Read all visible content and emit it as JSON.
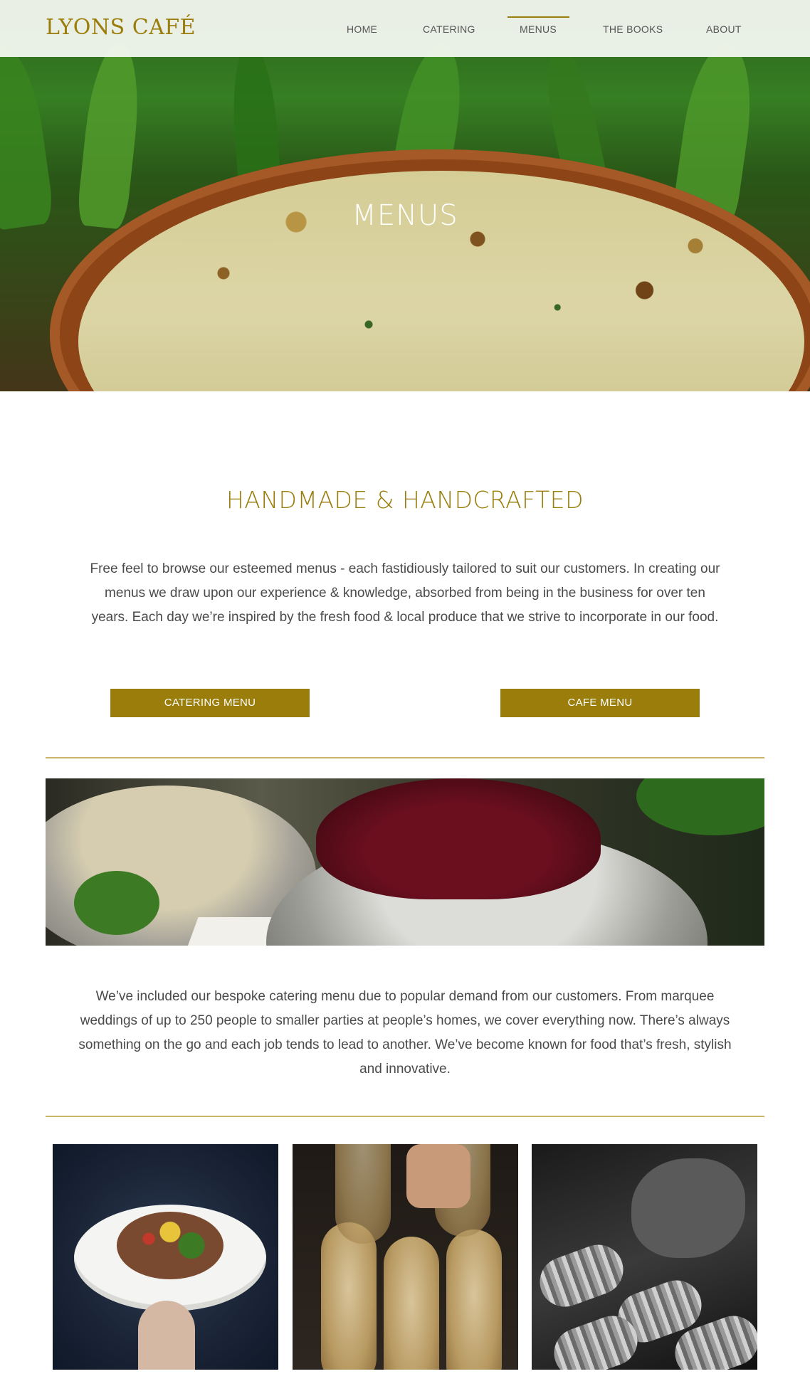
{
  "brand": {
    "name": "LYONS CAFÉ",
    "accent_color": "#9a7d0a"
  },
  "nav": {
    "items": [
      {
        "label": "HOME"
      },
      {
        "label": "CATERING"
      },
      {
        "label": "MENUS",
        "active": true
      },
      {
        "label": "THE BOOKS"
      },
      {
        "label": "ABOUT"
      }
    ]
  },
  "hero": {
    "title": "MENUS"
  },
  "intro": {
    "heading": "HANDMADE & HANDCRAFTED",
    "text": "Free feel to browse our esteemed menus - each fastidiously tailored to suit our customers. In creating our menus we draw upon our experience & knowledge, absorbed from being in the business for over ten years. Each day we’re inspired by the fresh food & local produce that we strive to incorporate in our food."
  },
  "buttons": {
    "catering": "CATERING MENU",
    "cafe": "CAFE MENU"
  },
  "catering": {
    "text": "We’ve included our bespoke catering menu due to popular demand from our customers. From marquee weddings of up to 250 people to smaller parties at people’s homes, we cover everything now. There’s always something on the go and each job tends to lead to another. We’ve become known for food that’s fresh, stylish and innovative."
  }
}
